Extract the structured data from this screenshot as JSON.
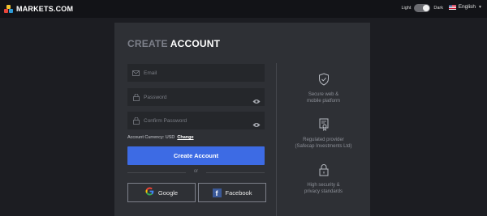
{
  "header": {
    "brand": "MARKETS.COM",
    "theme_light": "Light",
    "theme_dark": "Dark",
    "language": "English"
  },
  "form": {
    "title_light": "CREATE",
    "title_bold": "ACCOUNT",
    "email_placeholder": "Email",
    "password_placeholder": "Password",
    "confirm_placeholder": "Confirm Password",
    "currency_label": "Account Currency: USD",
    "currency_change": "Change",
    "submit_label": "Create Account",
    "or_label": "or",
    "google_label": "Google",
    "facebook_label": "Facebook"
  },
  "features": [
    {
      "line1": "Secure web &",
      "line2": "mobile platform",
      "icon": "shield-check-icon"
    },
    {
      "line1": "Regulated provider",
      "line2": "(Safecap Investments Ltd)",
      "icon": "certificate-icon"
    },
    {
      "line1": "High security &",
      "line2": "privacy standards",
      "icon": "lock-icon"
    }
  ],
  "colors": {
    "background": "#1c1d22",
    "topbar": "#121317",
    "panel": "#2e3035",
    "field": "#25272b",
    "primary_button": "#3d6be4",
    "facebook": "#3b5998"
  }
}
